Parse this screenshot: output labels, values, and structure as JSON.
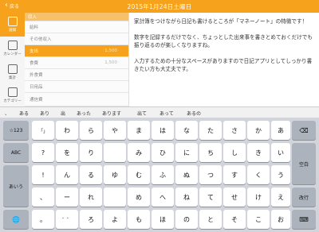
{
  "topbar": {
    "back_label": "戻る",
    "title": "2015年1月24日土曜日"
  },
  "sidebar": {
    "items": [
      {
        "label": "週間",
        "icon": "calendar-week-icon"
      },
      {
        "label": "カレンダー",
        "icon": "calendar-icon"
      },
      {
        "label": "集計",
        "icon": "chart-icon"
      },
      {
        "label": "カテゴリー",
        "icon": "category-icon"
      }
    ]
  },
  "list": {
    "rows": [
      {
        "label": "収入",
        "value": "",
        "style": "header"
      },
      {
        "label": "給料",
        "value": "",
        "style": "normal"
      },
      {
        "label": "その他収入",
        "value": "",
        "style": "normal"
      },
      {
        "label": "支出",
        "value": "1,500",
        "style": "selected"
      },
      {
        "label": "食費",
        "value": "1,500",
        "style": "normal"
      },
      {
        "label": "外食費",
        "value": "",
        "style": "normal"
      },
      {
        "label": "日用品",
        "value": "",
        "style": "normal"
      },
      {
        "label": "通信費",
        "value": "",
        "style": "normal"
      }
    ]
  },
  "editor": {
    "text": "家計簿をつけながら日記も書けるところが「マネーノート」の特徴です！\n\n数字を記録するだけでなく、ちょっとした出来事を書きとめておくだけでも振り返るのが楽しくなりますね。\n\n入力するための十分なスペースがありますので日記アプリとしてしっかり書きたい方も大丈夫です。"
  },
  "suggestions": [
    "、",
    "ある",
    "あり",
    "出",
    "あった",
    "あります",
    "出て",
    "あって",
    "あるの"
  ],
  "keyboard": {
    "left": [
      "☆123",
      "ABC",
      "あいう",
      "🌐"
    ],
    "right": [
      "⌫",
      "空白",
      "改行",
      "⌨"
    ],
    "grid": [
      [
        "「」",
        "わ",
        "ら",
        "や",
        "ま",
        "は",
        "な",
        "た",
        "さ",
        "か",
        "あ"
      ],
      [
        "?",
        "を",
        "り",
        "",
        "み",
        "ひ",
        "に",
        "ち",
        "し",
        "き",
        "い"
      ],
      [
        "!",
        "ん",
        "る",
        "ゆ",
        "む",
        "ふ",
        "ぬ",
        "つ",
        "す",
        "く",
        "う"
      ],
      [
        "、",
        "ー",
        "れ",
        "",
        "め",
        "へ",
        "ね",
        "て",
        "せ",
        "け",
        "え"
      ],
      [
        "。",
        "゛゜",
        "ろ",
        "よ",
        "も",
        "ほ",
        "の",
        "と",
        "そ",
        "こ",
        "お"
      ]
    ]
  }
}
